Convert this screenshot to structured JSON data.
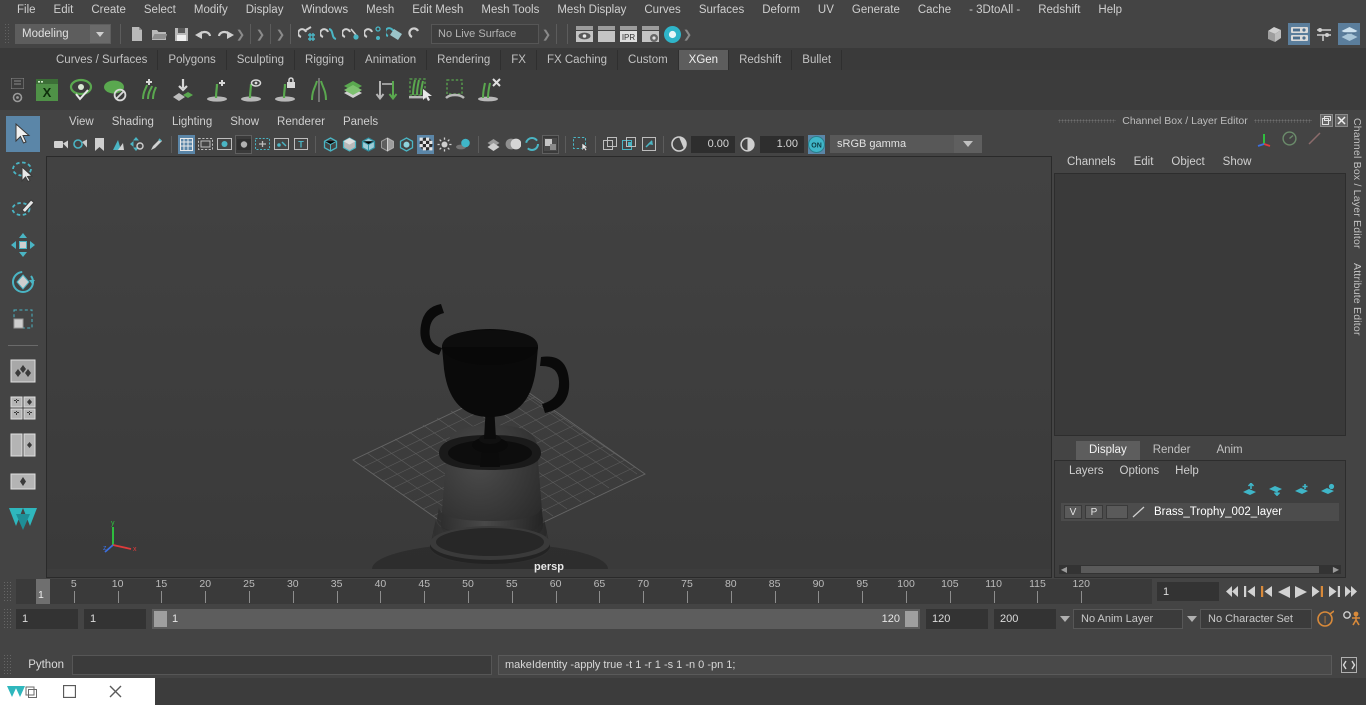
{
  "menubar": {
    "items": [
      "File",
      "Edit",
      "Create",
      "Select",
      "Modify",
      "Display",
      "Windows",
      "Mesh",
      "Edit Mesh",
      "Mesh Tools",
      "Mesh Display",
      "Curves",
      "Surfaces",
      "Deform",
      "UV",
      "Generate",
      "Cache",
      "- 3DtoAll -",
      "Redshift",
      "Help"
    ]
  },
  "statusbar": {
    "mode": "Modeling",
    "live_surface": "No Live Surface",
    "icons": [
      "new-scene-icon",
      "open-scene-icon",
      "save-scene-icon",
      "undo-icon",
      "redo-icon",
      "select-by-hierarchy-icon",
      "select-by-object-icon",
      "select-by-component-icon",
      "snap-grid-icon",
      "snap-curve-icon",
      "snap-point-icon",
      "snap-projected-center-icon",
      "snap-view-plane-icon",
      "snap-live-icon",
      "render-view-icon",
      "render-sequence-icon",
      "ipr-render-icon",
      "render-settings-icon",
      "hypershade-icon"
    ],
    "workspace_icons": [
      "show-hide-modeling-toolkit-icon",
      "show-hide-attribute-editor-icon",
      "show-hide-tool-settings-icon",
      "show-hide-channel-box-icon"
    ]
  },
  "shelf": {
    "tabs": [
      "Curves / Surfaces",
      "Polygons",
      "Sculpting",
      "Rigging",
      "Animation",
      "Rendering",
      "FX",
      "FX Caching",
      "Custom",
      "XGen",
      "Redshift",
      "Bullet"
    ],
    "active_tab": "XGen",
    "icons": [
      "xgen-editor-icon",
      "xgen-preview-icon",
      "xgen-disable-preview-icon",
      "xgen-add-guides-icon",
      "xgen-import-collection-icon",
      "xgen-add-description-icon",
      "xgen-preview-description-icon",
      "xgen-lock-description-icon",
      "xgen-mirror-guides-icon",
      "xgen-layers-icon",
      "xgen-convert-to-interactive-icon",
      "xgen-select-region-icon",
      "xgen-clear-region-icon",
      "xgen-delete-guides-icon"
    ]
  },
  "toolbox": {
    "tools": [
      "select-tool",
      "lasso-select-tool",
      "paint-select-tool",
      "move-tool",
      "rotate-tool",
      "scale-tool",
      "last-tool",
      "single-pane-layout",
      "four-pane-layout",
      "outliner-persp-layout",
      "persp-graph-layout"
    ],
    "active": "select-tool"
  },
  "viewport": {
    "menus": [
      "View",
      "Shading",
      "Lighting",
      "Show",
      "Renderer",
      "Panels"
    ],
    "camera_label": "persp",
    "exposure": "0.00",
    "gamma": "1.00",
    "color_toggle": "ON",
    "color_space": "sRGB gamma",
    "toolbar_icons": [
      "select-camera-icon",
      "camera-attributes-icon",
      "bookmark-icon",
      "image-plane-icon",
      "two-d-pan-zoom-icon",
      "grease-pencil-icon",
      "grid-toggle-icon",
      "film-gate-icon",
      "resolution-gate-icon",
      "gate-mask-icon",
      "film-origin-icon",
      "safe-action-icon",
      "xray-joints-icon",
      "wireframe-icon",
      "smooth-shade-all-icon",
      "shade-wireframe-icon",
      "textured-icon",
      "use-all-lights-icon",
      "shadows-icon",
      "screen-space-ao-icon",
      "motion-blur-icon",
      "multisample-icon",
      "depth-of-field-icon",
      "isolate-select-icon",
      "xray-icon",
      "xray-active-icon",
      "xray-joints-2-icon",
      "exposure-icon"
    ]
  },
  "channelbox": {
    "title": "Channel Box / Layer Editor",
    "menus": [
      "Channels",
      "Edit",
      "Object",
      "Show"
    ],
    "header_icons": [
      "axis-gizmo-icon",
      "speedometer-icon",
      "slash-icon"
    ],
    "window_buttons": [
      "undock-icon",
      "close-icon"
    ],
    "side_rail_top": "Channel Box / Layer Editor",
    "side_rail_bottom": "Attribute Editor"
  },
  "layereditor": {
    "tabs": [
      "Display",
      "Render",
      "Anim"
    ],
    "active_tab": "Display",
    "menus": [
      "Layers",
      "Options",
      "Help"
    ],
    "arrow_icons": [
      "move-layer-up-icon",
      "move-layer-down-icon",
      "new-layer-icon",
      "new-layer-from-selected-icon"
    ],
    "layers": [
      {
        "visibility": "V",
        "playback": "P",
        "shading": "",
        "name": "Brass_Trophy_002_layer"
      }
    ]
  },
  "timeline": {
    "ticks": [
      5,
      10,
      15,
      20,
      25,
      30,
      35,
      40,
      45,
      50,
      55,
      60,
      65,
      70,
      75,
      80,
      85,
      90,
      95,
      100,
      105,
      110,
      115,
      120
    ],
    "current_frame": "1",
    "frame_field": "1",
    "playback_buttons": [
      "go-to-start-icon",
      "step-back-keyframe-icon",
      "step-back-frame-icon",
      "play-backwards-icon",
      "play-forwards-icon",
      "step-forward-frame-icon",
      "step-forward-keyframe-icon",
      "go-to-end-icon"
    ]
  },
  "rangeslider": {
    "anim_start": "1",
    "range_start": "1",
    "bar_start": "1",
    "bar_end": "120",
    "range_end": "120",
    "anim_end": "200",
    "anim_layer": "No Anim Layer",
    "character_set": "No Character Set",
    "right_icons": [
      "auto-keyframe-icon",
      "animation-preferences-icon"
    ]
  },
  "commandline": {
    "language": "Python",
    "input_value": "",
    "status_message": "makeIdentity -apply true -t 1 -r 1 -s 1 -n 0 -pn 1;",
    "script-editor-icon": "script-editor-icon"
  },
  "taskbar": {
    "buttons": [
      "maya-app-icon",
      "restore-window-icon",
      "maximize-window-icon",
      "close-window-icon"
    ]
  },
  "colors": {
    "accent_blue": "#5b86a8",
    "shelf_green": "#6aa84f",
    "teal": "#4ab5c4",
    "panel_bg": "#444444",
    "viewport_bg": "#3d3d3d",
    "orange": "#d98a3a"
  }
}
